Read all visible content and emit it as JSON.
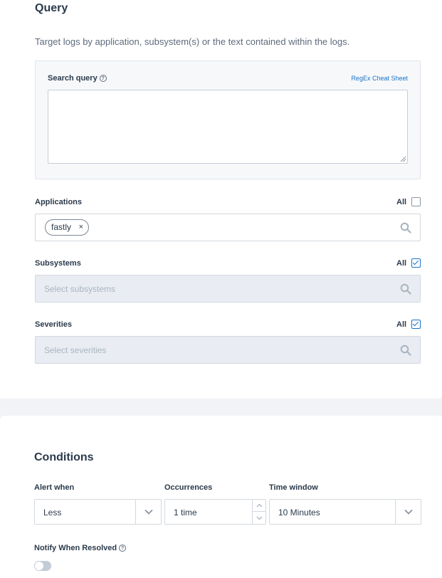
{
  "query": {
    "title": "Query",
    "description": "Target logs by application, subsystem(s) or the text contained within the logs.",
    "search_label": "Search query",
    "regex_link": "RegEx Cheat Sheet",
    "search_value": ""
  },
  "applications": {
    "label": "Applications",
    "all_label": "All",
    "all_checked": false,
    "chips": [
      "fastly"
    ],
    "chip_remove": "×"
  },
  "subsystems": {
    "label": "Subsystems",
    "all_label": "All",
    "all_checked": true,
    "placeholder": "Select subsystems"
  },
  "severities": {
    "label": "Severities",
    "all_label": "All",
    "all_checked": true,
    "placeholder": "Select severities"
  },
  "conditions": {
    "title": "Conditions",
    "alert_when_label": "Alert when",
    "alert_when_value": "Less",
    "occurrences_label": "Occurrences",
    "occurrences_value": "1 time",
    "time_window_label": "Time window",
    "time_window_value": "10 Minutes",
    "notify_label": "Notify When Resolved",
    "notify_on": false
  },
  "colors": {
    "accent": "#1a73c9",
    "text": "#2b3a4b",
    "disabled_bg": "#e9edf3"
  }
}
